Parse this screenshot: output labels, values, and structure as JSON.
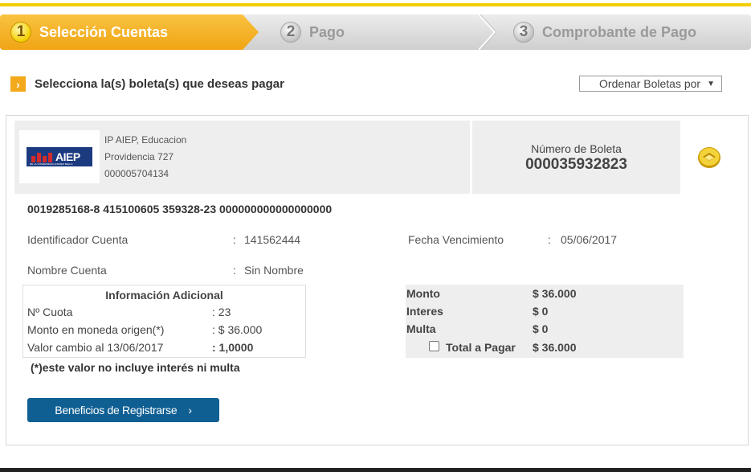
{
  "steps": [
    {
      "num": "1",
      "label": "Selección Cuentas",
      "active": true
    },
    {
      "num": "2",
      "label": "Pago",
      "active": false
    },
    {
      "num": "3",
      "label": "Comprobante de Pago",
      "active": false
    }
  ],
  "section": {
    "title": "Selecciona la(s) boleta(s) que deseas pagar",
    "arrow": "›"
  },
  "order": {
    "label": "Ordenar Boletas por",
    "caret": "▼"
  },
  "company": {
    "logo_text": "AIEP",
    "logo_sub": "DE LA UNIVERSIDAD ANDRES BELLO",
    "name": "IP AIEP, Educacion",
    "address": "Providencia 727",
    "code": "000005704134"
  },
  "boleta": {
    "label": "Número de Boleta",
    "number": "000035932823"
  },
  "barcode": "0019285168-8 415100605 359328-23 000000000000000000",
  "fields": {
    "identificador_label": "Identificador Cuenta",
    "identificador_value": "141562444",
    "fecha_label": "Fecha Vencimiento",
    "fecha_value": "05/06/2017",
    "nombre_label": "Nombre Cuenta",
    "nombre_value": "Sin Nombre",
    "sep": ":"
  },
  "adicional": {
    "title": "Información Adicional",
    "rows": [
      {
        "label": "Nº Cuota",
        "value": ": 23"
      },
      {
        "label": "Monto en moneda origen(*)",
        "value": ": $ 36.000"
      },
      {
        "label": "Valor cambio al 13/06/2017",
        "value": ": 1,0000"
      }
    ],
    "note": "(*)este valor no incluye interés ni multa"
  },
  "totals": {
    "monto_label": "Monto",
    "monto_value": "$ 36.000",
    "interes_label": "Interes",
    "interes_value": "$ 0",
    "multa_label": "Multa",
    "multa_value": "$ 0",
    "total_label": "Total a Pagar",
    "total_value": "$ 36.000"
  },
  "button": {
    "label": "Beneficios de Registrarse",
    "chevron": "›"
  },
  "colors": {
    "accent": "#f2a91a",
    "button": "#0f5f93",
    "topline": "#f4cd00"
  }
}
